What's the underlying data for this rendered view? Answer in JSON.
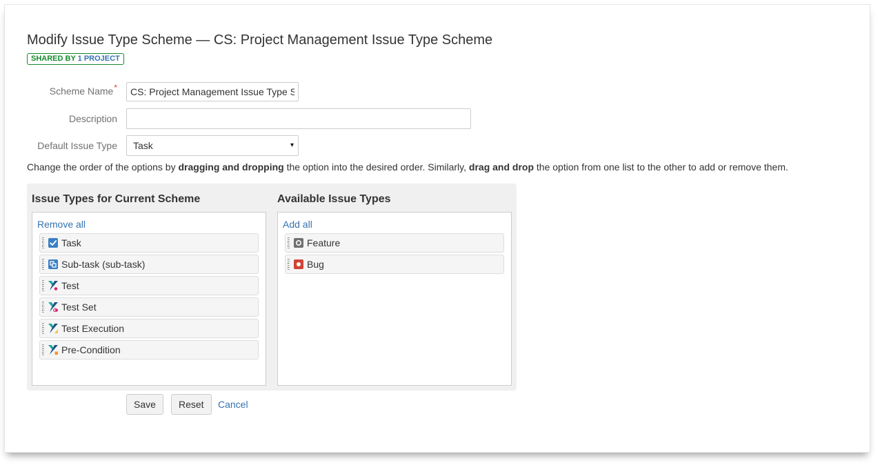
{
  "page": {
    "title": "Modify Issue Type Scheme — CS: Project Management Issue Type Scheme",
    "badge_shared": "SHARED BY",
    "badge_projects": "1 PROJECT"
  },
  "form": {
    "scheme_name_label": "Scheme Name",
    "required_mark": "*",
    "scheme_name_value": "CS: Project Management Issue Type Scheme",
    "description_label": "Description",
    "description_value": "",
    "default_type_label": "Default Issue Type",
    "default_type_value": "Task",
    "select_caret": "▾"
  },
  "instructions": {
    "part1": "Change the order of the options by ",
    "bold1": "dragging and dropping",
    "part2": " the option into the desired order. Similarly, ",
    "bold2": "drag and drop",
    "part3": " the option from one list to the other to add or remove them."
  },
  "current": {
    "title": "Issue Types for Current Scheme",
    "remove_all": "Remove all",
    "items": [
      {
        "label": "Task",
        "icon": "task-icon"
      },
      {
        "label": "Sub-task (sub-task)",
        "icon": "subtask-icon"
      },
      {
        "label": "Test",
        "icon": "xray-test-icon"
      },
      {
        "label": "Test Set",
        "icon": "xray-test-set-icon"
      },
      {
        "label": "Test Execution",
        "icon": "xray-test-execution-icon"
      },
      {
        "label": "Pre-Condition",
        "icon": "xray-precondition-icon"
      }
    ]
  },
  "available": {
    "title": "Available Issue Types",
    "add_all": "Add all",
    "items": [
      {
        "label": "Feature",
        "icon": "feature-icon"
      },
      {
        "label": "Bug",
        "icon": "bug-icon"
      }
    ]
  },
  "actions": {
    "save": "Save",
    "reset": "Reset",
    "cancel": "Cancel"
  },
  "colors": {
    "link": "#3572b0",
    "badge_green": "#14892c",
    "task_blue": "#3b7fc4",
    "bug_red": "#d04437",
    "feature_gray": "#707070",
    "xray_teal": "#1ea6a0",
    "xray_pink": "#d6246e"
  }
}
